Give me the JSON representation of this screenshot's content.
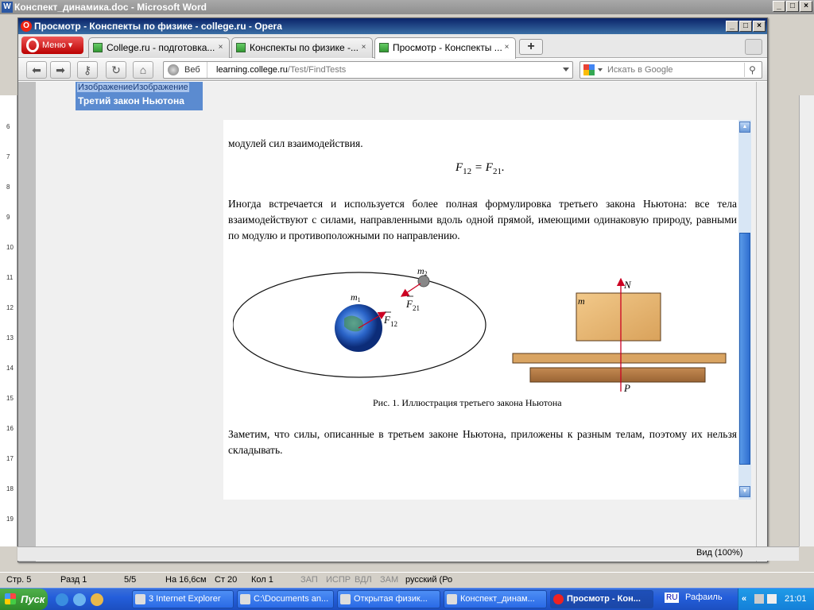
{
  "word": {
    "title": "Конспект_динамика.doc - Microsoft Word",
    "ruler_numbers": [
      "6",
      "7",
      "8",
      "9",
      "10",
      "11",
      "12",
      "13",
      "14",
      "15",
      "16",
      "17",
      "18",
      "19"
    ],
    "status": {
      "page": "Стр. 5",
      "section": "Разд 1",
      "pages": "5/5",
      "at": "На 16,6см",
      "line": "Ст 20",
      "col": "Кол 1",
      "rec": "ЗАП",
      "trk": "ИСПР",
      "ext": "ВДЛ",
      "ovr": "ЗАМ",
      "lang": "русский (Ро"
    },
    "view_zoom": "Вид (100%)"
  },
  "opera": {
    "title": "Просмотр - Конспекты по физике - college.ru - Opera",
    "menu_label": "Меню",
    "tabs": [
      {
        "label": "College.ru - подготовка..."
      },
      {
        "label": "Конспекты по физике -..."
      },
      {
        "label": "Просмотр - Конспекты ...",
        "active": true
      }
    ],
    "address": {
      "mode": "Веб",
      "host": "learning.college.ru",
      "path": "/Test/FindTests"
    },
    "search_placeholder": "Искать в Google"
  },
  "page": {
    "breadcrumb_img1": "Изображение",
    "breadcrumb_img2": "Изображение",
    "breadcrumb_title": "Третий закон Ньютона",
    "para1": "модулей сил взаимодействия.",
    "formula": {
      "lhs": "F",
      "lhs_sub": "12",
      "eq": "=",
      "rhs": "F",
      "rhs_sub": "21",
      "end": "."
    },
    "para2": "Иногда встречается и используется более полная формулировка третьего закона Ньютона: все тела взаимодействуют с силами, направленными вдоль одной прямой, имеющими одинаковую природу, равными по модулю и противоположными по направлению.",
    "figure_labels": {
      "m1": "m",
      "m1_sub": "1",
      "m2": "m",
      "m2_sub": "2",
      "f12": "F",
      "f12_sub": "12",
      "f21": "F",
      "f21_sub": "21",
      "m": "m",
      "n": "N",
      "p": "P"
    },
    "caption": "Рис. 1. Иллюстрация третьего закона Ньютона",
    "para3": "Заметим, что силы, описанные в третьем законе Ньютона, приложены к разным телам, поэтому их нельзя складывать."
  },
  "taskbar": {
    "start": "Пуск",
    "items": [
      {
        "label": "3 Internet Explorer"
      },
      {
        "label": "C:\\Documents an..."
      },
      {
        "label": "Открытая физик..."
      },
      {
        "label": "Конспект_динам..."
      },
      {
        "label": "Просмотр - Кон...",
        "active": true
      }
    ],
    "lang": "RU",
    "user": "Рафаиль",
    "time": "21:01"
  },
  "colors": {
    "accent": "#0a246a",
    "opera_red": "#cc1111",
    "force_arrow": "#cc0022",
    "breadcrumb_bg": "#5b8bd0"
  }
}
